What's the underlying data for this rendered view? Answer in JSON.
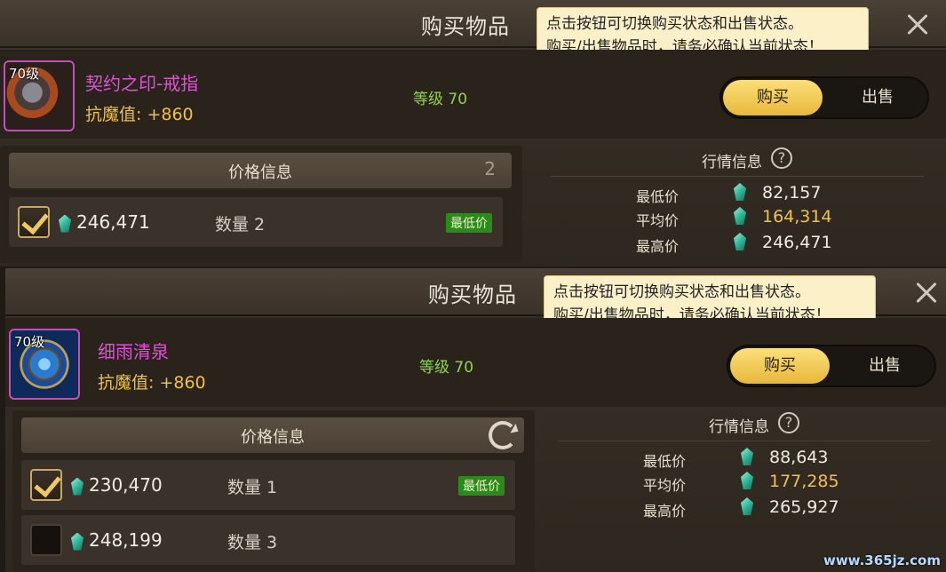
{
  "panels": [
    {
      "title": "购买物品",
      "tooltip_line1": "点击按钮可切换购买状态和出售状态。",
      "tooltip_line2": "购买/出售物品时，请务必确认当前状态！",
      "item": {
        "level_tag": "70级",
        "name": "契约之印-戒指",
        "attr": "抗魔值: +860",
        "level": "等级 70",
        "icon": "ring-icon"
      },
      "toggle": {
        "buy": "购买",
        "sell": "出售"
      },
      "price_info": {
        "title": "价格信息",
        "count": "2",
        "rows": [
          {
            "checked": true,
            "price": "246,471",
            "qty": "数量 2",
            "badge": "最低价"
          }
        ]
      },
      "market": {
        "title": "行情信息",
        "help": "?",
        "min_label": "最低价",
        "min_value": "82,157",
        "avg_label": "平均价",
        "avg_value": "164,314",
        "max_label": "最高价",
        "max_value": "246,471"
      }
    },
    {
      "title": "购买物品",
      "tooltip_line1": "点击按钮可切换购买状态和出售状态。",
      "tooltip_line2": "购买/出售物品时，请务必确认当前状态！",
      "item": {
        "level_tag": "70级",
        "name": "细雨清泉",
        "attr": "抗魔值: +860",
        "level": "等级 70",
        "icon": "orb-icon"
      },
      "toggle": {
        "buy": "购买",
        "sell": "出售"
      },
      "price_info": {
        "title": "价格信息",
        "rows": [
          {
            "checked": true,
            "price": "230,470",
            "qty": "数量 1",
            "badge": "最低价"
          },
          {
            "checked": false,
            "price": "248,199",
            "qty": "数量 3",
            "badge": ""
          }
        ]
      },
      "market": {
        "title": "行情信息",
        "help": "?",
        "min_label": "最低价",
        "min_value": "88,643",
        "avg_label": "平均价",
        "avg_value": "177,285",
        "max_label": "最高价",
        "max_value": "265,927"
      }
    }
  ],
  "colors": {
    "item_name": "#e04fd8",
    "attr": "#f0c040",
    "level": "#8fd44a",
    "avg_price": "#f0c050",
    "badge": "#2a8a1a"
  },
  "watermark": "www.365jz.com"
}
